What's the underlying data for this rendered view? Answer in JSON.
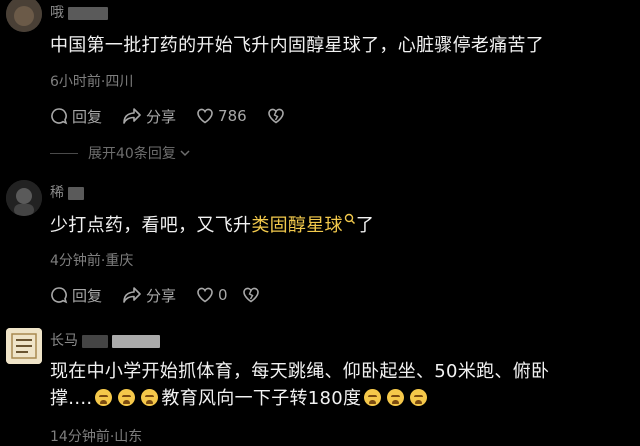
{
  "comments": [
    {
      "username": "哦",
      "text": "中国第一批打药的开始飞升内固醇星球了，心脏骤停老痛苦了",
      "meta": "6小时前·四川",
      "reply_label": "回复",
      "share_label": "分享",
      "like_count": "786",
      "expand_label": "展开40条回复"
    },
    {
      "username": "稀",
      "text_prefix": "少打点药，看吧，又飞升",
      "text_highlight": "类固醇星球",
      "text_suffix": "了",
      "meta": "4分钟前·重庆",
      "reply_label": "回复",
      "share_label": "分享",
      "like_count": "0"
    },
    {
      "username": "长马",
      "text_line1": "现在中小学开始抓体育，每天跳绳、仰卧起坐、50米跑、俯卧",
      "text_line2_a": "撑....",
      "text_line2_b": "教育风向一下子转180度",
      "meta": "14分钟前·山东"
    }
  ],
  "icons": {
    "reply": "comment-bubble-icon",
    "share": "share-arrow-icon",
    "like": "heart-icon",
    "dislike": "broken-heart-icon",
    "expand": "chevron-down-icon",
    "search": "search-icon",
    "emoji": "crying-face-emoji"
  },
  "colors": {
    "background": "#000000",
    "highlight": "#f2c94c",
    "meta": "#7e7e7e"
  }
}
